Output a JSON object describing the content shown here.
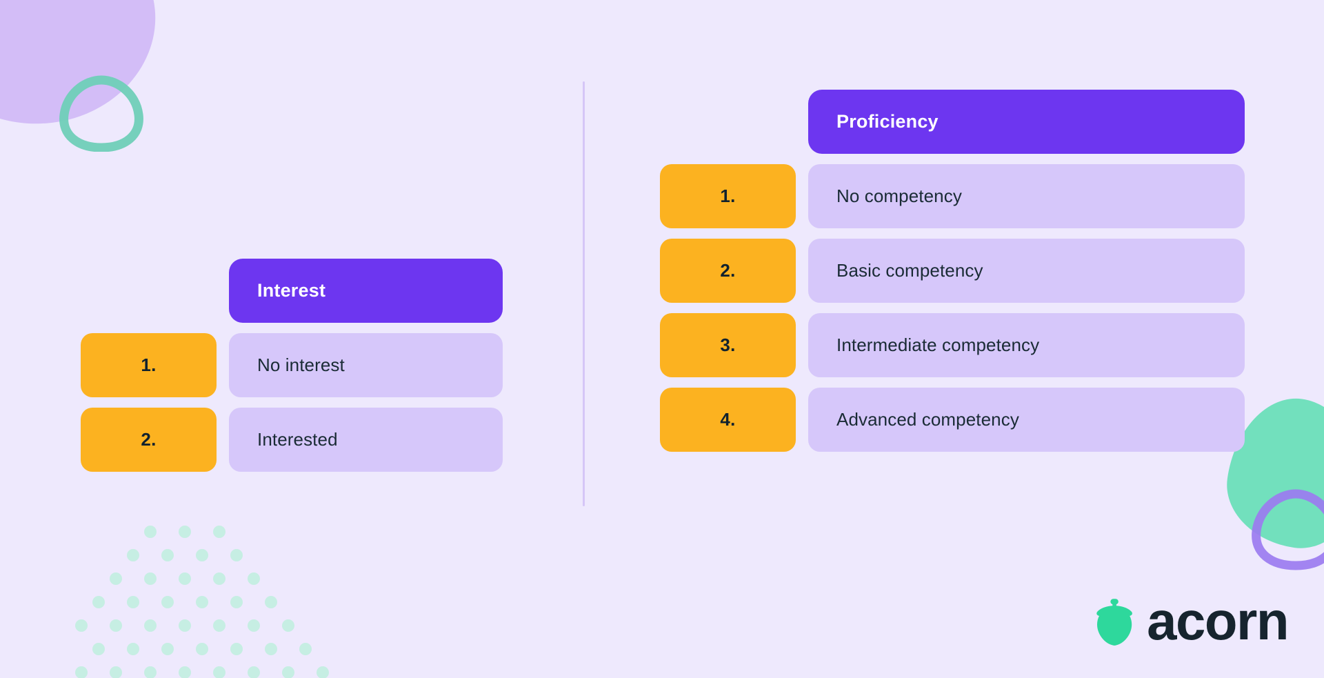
{
  "background_color": "#eee9fd",
  "theme": {
    "header_purple": "#6d36f0",
    "row_lavender": "#d6c7fa",
    "badge_amber": "#fcb220",
    "text_dark": "#1a2b35",
    "accent_mint": "#2ed89c",
    "divider": "#d5c6f7"
  },
  "columns": [
    {
      "header": "Interest",
      "rows": [
        {
          "rank": "1.",
          "label": "No interest"
        },
        {
          "rank": "2.",
          "label": "Interested"
        }
      ]
    },
    {
      "header": "Proficiency",
      "rows": [
        {
          "rank": "1.",
          "label": "No competency"
        },
        {
          "rank": "2.",
          "label": "Basic competency"
        },
        {
          "rank": "3.",
          "label": "Intermediate competency"
        },
        {
          "rank": "4.",
          "label": "Advanced competency"
        }
      ]
    }
  ],
  "logo": {
    "wordmark": "acorn",
    "mark_icon": "acorn-icon",
    "mark_color": "#2ed89c",
    "wordmark_color": "#16242e"
  },
  "decorations": [
    {
      "name": "purple-blob-top-left",
      "color": "#cdb3f5"
    },
    {
      "name": "teal-triangle-outline-top-left",
      "color": "#6fcfb8"
    },
    {
      "name": "mint-blob-bottom-right",
      "color": "#64dfb6"
    },
    {
      "name": "purple-triangle-outline-bottom-right",
      "color": "#9b7bf0"
    },
    {
      "name": "mint-dot-grid-bottom-left",
      "color": "#c6eee3"
    }
  ]
}
